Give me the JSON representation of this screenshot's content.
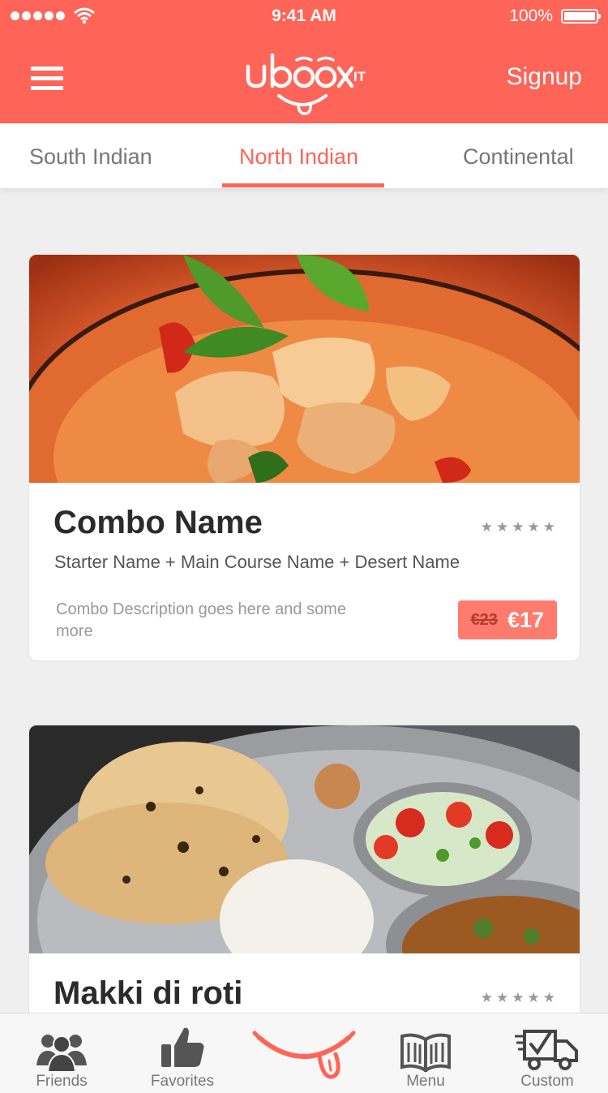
{
  "status_bar": {
    "time": "9:41 AM",
    "battery": "100%"
  },
  "header": {
    "signup_label": "Signup",
    "logo_text": "uboxit"
  },
  "tabs": [
    {
      "label": "South Indian",
      "active": false
    },
    {
      "label": "North Indian",
      "active": true
    },
    {
      "label": "Continental",
      "active": false
    }
  ],
  "cards": [
    {
      "name": "Combo Name",
      "items": "Starter Name + Main Course Name + Desert Name",
      "description": "Combo Description goes here and some more",
      "old_price": "€23",
      "price": "€17",
      "rating": "★★★★★"
    },
    {
      "name": "Makki di roti",
      "rating": "★★★★★"
    }
  ],
  "bottom_nav": [
    {
      "label": "Friends",
      "icon": "friends-icon"
    },
    {
      "label": "Favorites",
      "icon": "thumbs-up-icon"
    },
    {
      "label": "",
      "icon": "uboxit-smile-icon"
    },
    {
      "label": "Menu",
      "icon": "book-icon"
    },
    {
      "label": "Custom",
      "icon": "delivery-truck-icon"
    }
  ],
  "colors": {
    "accent": "#ff6458",
    "price_badge": "#ff7b6e",
    "background": "#efefef"
  }
}
